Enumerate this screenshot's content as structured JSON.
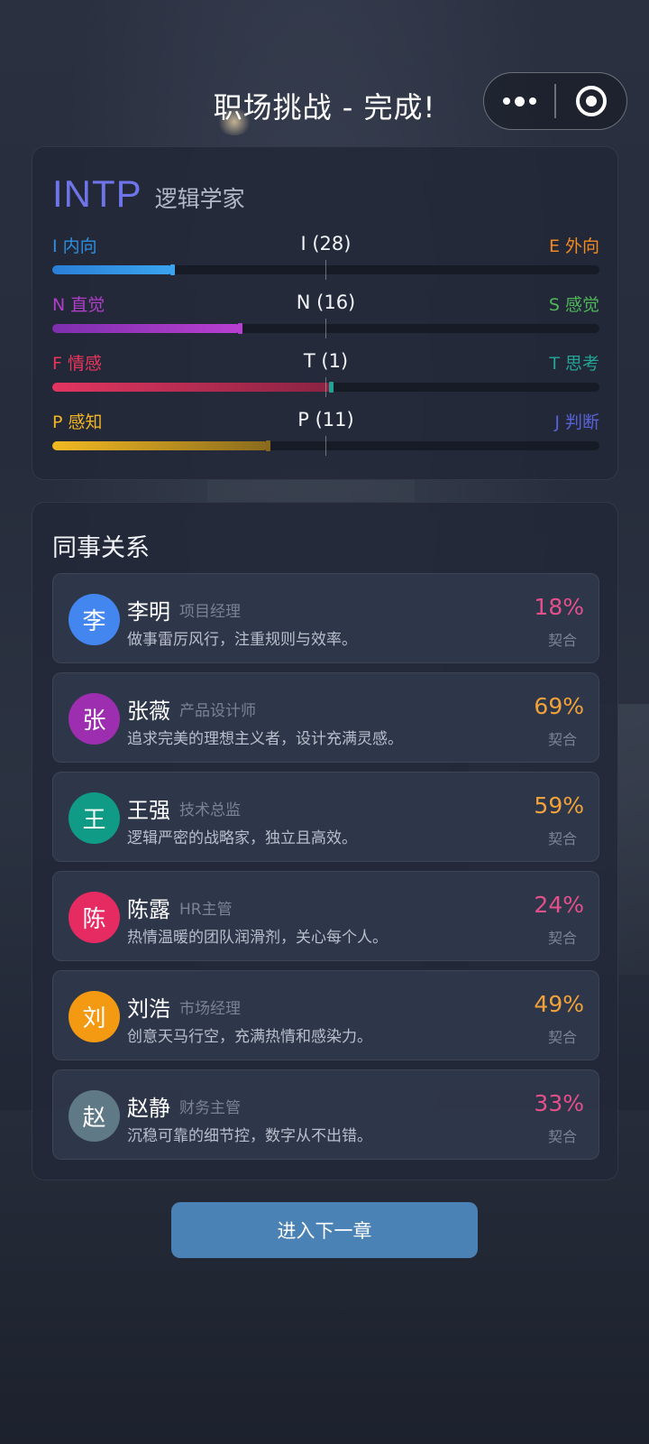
{
  "header": {
    "title": "职场挑战 - 完成!"
  },
  "capsule": {
    "more_icon": "more-dots-icon",
    "close_icon": "target-close-icon"
  },
  "mbti": {
    "type": "INTP",
    "name": "逻辑学家",
    "dimensions": [
      {
        "left_label": "I 内向",
        "right_label": "E 外向",
        "score_label": "I (28)",
        "fill_fraction": 0.22,
        "color_left": "#2e8fe0",
        "color_right": "#f08a24",
        "fill_from": "#2a7fd6",
        "fill_to": "#3aa4f0"
      },
      {
        "left_label": "N 直觉",
        "right_label": "S 感觉",
        "score_label": "N (16)",
        "fill_fraction": 0.345,
        "color_left": "#b03ec8",
        "color_right": "#4fb65a",
        "fill_from": "#7d2fae",
        "fill_to": "#b93fd0"
      },
      {
        "left_label": "F 情感",
        "right_label": "T 思考",
        "score_label": "T (1)",
        "fill_fraction": 0.51,
        "color_left": "#e8365c",
        "color_right": "#22a394",
        "fill_from": "#e23560",
        "fill_to": "#8a2343"
      },
      {
        "left_label": "P 感知",
        "right_label": "J 判断",
        "score_label": "P (11)",
        "fill_fraction": 0.395,
        "color_left": "#f2b525",
        "color_right": "#5a62d8",
        "fill_from": "#f2b922",
        "fill_to": "#8a6b1d"
      }
    ]
  },
  "coworkers": {
    "title": "同事关系",
    "match_label": "契合",
    "items": [
      {
        "initial": "李",
        "name": "李明",
        "role": "项目经理",
        "desc": "做事雷厉风行，注重规则与效率。",
        "pct": "18%",
        "avatar_color": "#4386f0",
        "pct_color": "#e3508a"
      },
      {
        "initial": "张",
        "name": "张薇",
        "role": "产品设计师",
        "desc": "追求完美的理想主义者，设计充满灵感。",
        "pct": "69%",
        "avatar_color": "#9d2eb0",
        "pct_color": "#f2a23a"
      },
      {
        "initial": "王",
        "name": "王强",
        "role": "技术总监",
        "desc": "逻辑严密的战略家，独立且高效。",
        "pct": "59%",
        "avatar_color": "#0f9b86",
        "pct_color": "#f2a23a"
      },
      {
        "initial": "陈",
        "name": "陈露",
        "role": "HR主管",
        "desc": "热情温暖的团队润滑剂，关心每个人。",
        "pct": "24%",
        "avatar_color": "#e62a62",
        "pct_color": "#e3508a"
      },
      {
        "initial": "刘",
        "name": "刘浩",
        "role": "市场经理",
        "desc": "创意天马行空，充满热情和感染力。",
        "pct": "49%",
        "avatar_color": "#f39a12",
        "pct_color": "#f2a23a"
      },
      {
        "initial": "赵",
        "name": "赵静",
        "role": "财务主管",
        "desc": "沉稳可靠的细节控，数字从不出错。",
        "pct": "33%",
        "avatar_color": "#5f7a86",
        "pct_color": "#e3508a"
      }
    ]
  },
  "next_button": {
    "label": "进入下一章"
  }
}
